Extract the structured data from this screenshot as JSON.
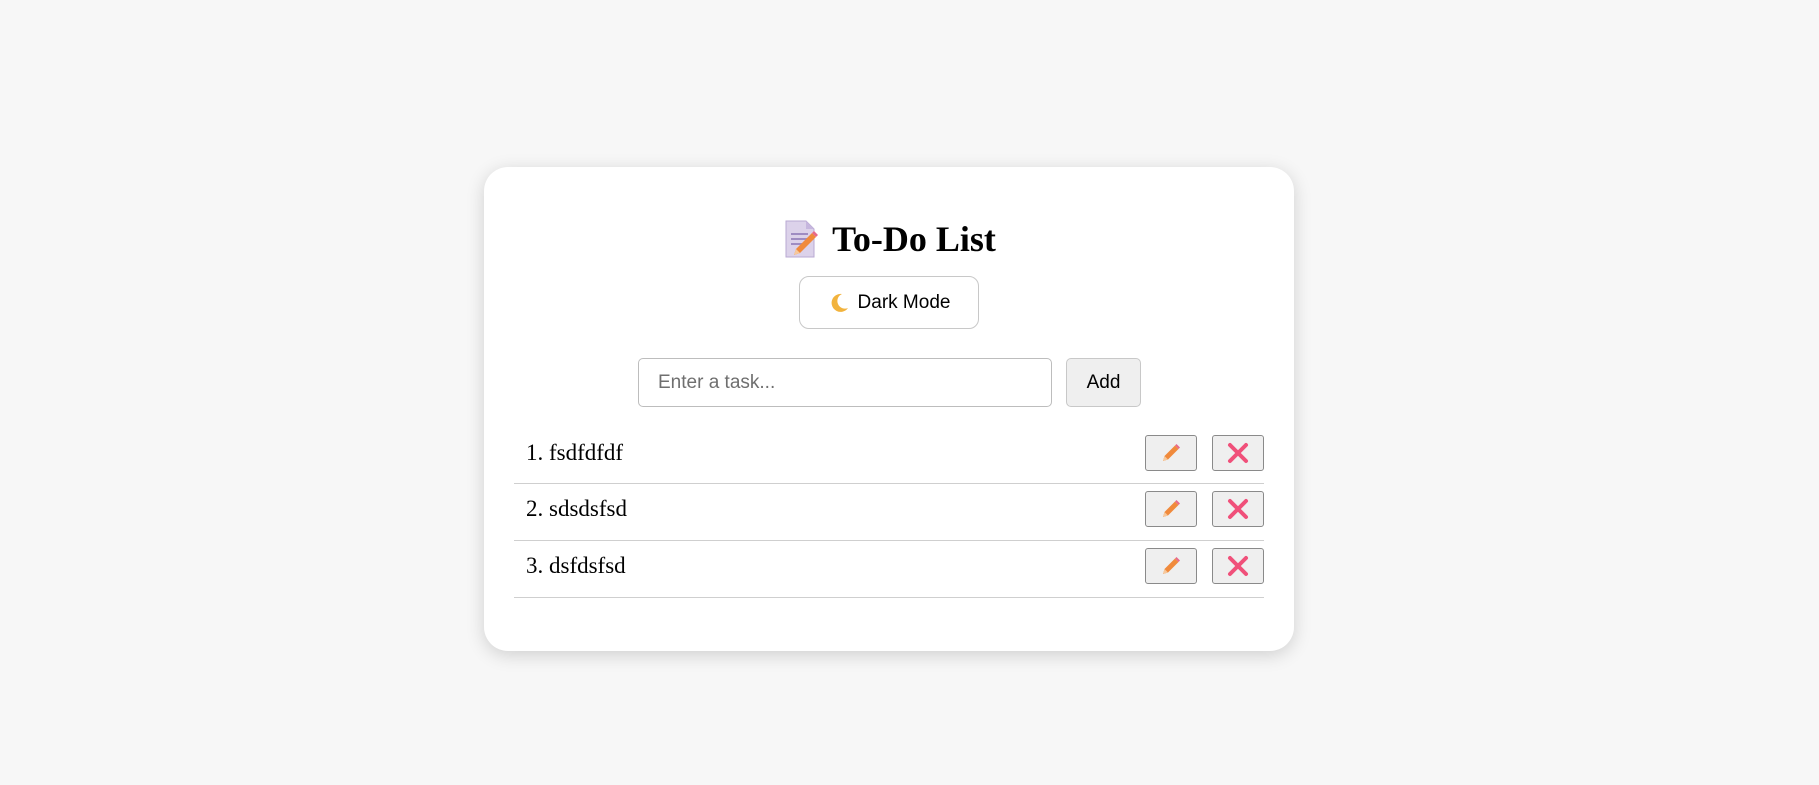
{
  "app": {
    "title": "To-Do List",
    "title_icon": "memo-icon"
  },
  "theme_toggle": {
    "label": "Dark Mode",
    "icon": "moon-icon"
  },
  "input": {
    "placeholder": "Enter a task...",
    "value": ""
  },
  "add_button": {
    "label": "Add"
  },
  "tasks": [
    {
      "text": "1. fsdfdfdf"
    },
    {
      "text": "2. sdsdsfsd"
    },
    {
      "text": "3. dsfdsfsd"
    }
  ],
  "task_actions": {
    "edit_icon": "pencil-icon",
    "delete_icon": "cross-mark-icon"
  },
  "colors": {
    "background": "#f7f7f7",
    "card": "#ffffff",
    "pencil": "#f08a3c",
    "cross": "#f0507a"
  }
}
